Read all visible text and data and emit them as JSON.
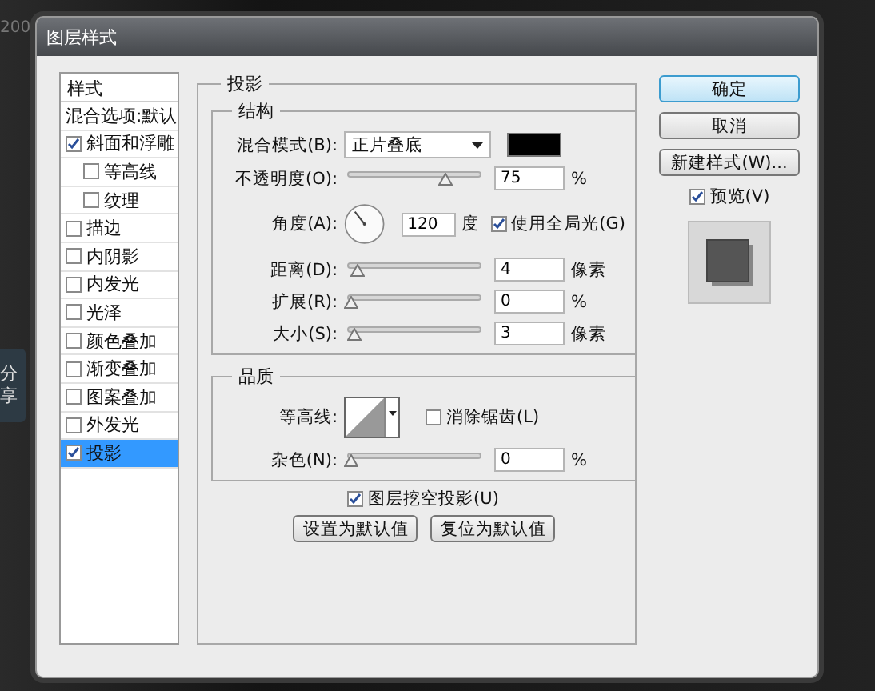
{
  "background": {
    "corner_text": "200",
    "share_tab": "分享"
  },
  "dialog": {
    "title": "图层样式"
  },
  "styles_list": {
    "header": "样式",
    "blend_options": "混合选项:默认",
    "items": [
      {
        "label": "斜面和浮雕",
        "checked": true,
        "selected": false,
        "children": [
          {
            "label": "等高线",
            "checked": false,
            "selected": false
          },
          {
            "label": "纹理",
            "checked": false,
            "selected": false
          }
        ]
      },
      {
        "label": "描边",
        "checked": false,
        "selected": false
      },
      {
        "label": "内阴影",
        "checked": false,
        "selected": false
      },
      {
        "label": "内发光",
        "checked": false,
        "selected": false
      },
      {
        "label": "光泽",
        "checked": false,
        "selected": false
      },
      {
        "label": "颜色叠加",
        "checked": false,
        "selected": false
      },
      {
        "label": "渐变叠加",
        "checked": false,
        "selected": false
      },
      {
        "label": "图案叠加",
        "checked": false,
        "selected": false
      },
      {
        "label": "外发光",
        "checked": false,
        "selected": false
      },
      {
        "label": "投影",
        "checked": true,
        "selected": true
      }
    ]
  },
  "drop_shadow": {
    "title": "投影",
    "structure": {
      "title": "结构",
      "blend_mode": {
        "label": "混合模式(B):",
        "value": "正片叠底",
        "color": "#000000"
      },
      "opacity": {
        "label": "不透明度(O):",
        "level": 0.75,
        "value": "75",
        "unit": "%"
      },
      "angle": {
        "label": "角度(A):",
        "value": "120",
        "unit": "度",
        "global_light": {
          "label": "使用全局光(G)",
          "checked": true
        }
      },
      "sliders": [
        {
          "label": "距离(D):",
          "level": 0.05,
          "value": "4",
          "unit": "像素"
        },
        {
          "label": "扩展(R):",
          "level": 0,
          "value": "0",
          "unit": "%"
        },
        {
          "label": "大小(S):",
          "level": 0.03,
          "value": "3",
          "unit": "像素"
        }
      ]
    },
    "quality": {
      "title": "品质",
      "contour": {
        "label": "等高线:",
        "anti_alias": {
          "label": "消除锯齿(L)",
          "checked": false
        }
      },
      "noise": {
        "label": "杂色(N):",
        "level": 0,
        "value": "0",
        "unit": "%"
      }
    },
    "knockout": {
      "label": "图层挖空投影(U)",
      "checked": true
    },
    "buttons": [
      "设置为默认值",
      "复位为默认值"
    ]
  },
  "actions": {
    "buttons": [
      {
        "label": "确定",
        "default": true
      },
      {
        "label": "取消",
        "default": false
      },
      {
        "label": "新建样式(W)...",
        "default": false
      }
    ],
    "preview": {
      "label": "预览(V)",
      "checked": true
    }
  }
}
